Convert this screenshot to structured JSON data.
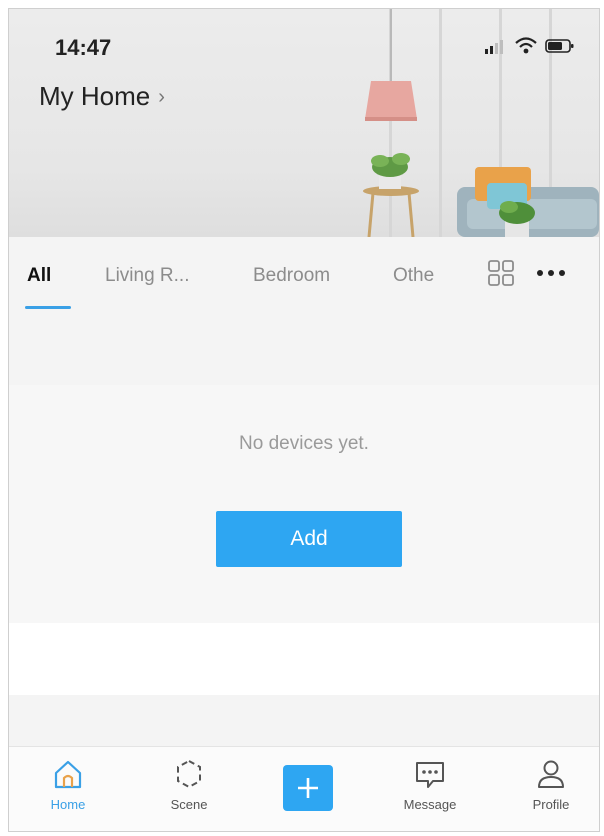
{
  "status_bar": {
    "time": "14:47"
  },
  "header": {
    "home_name": "My Home",
    "chevron": "›"
  },
  "tabs": [
    {
      "label": "All",
      "active": true
    },
    {
      "label": "Living R..."
    },
    {
      "label": "Bedroom"
    },
    {
      "label": "Othe"
    }
  ],
  "empty_state": {
    "message": "No devices yet.",
    "add_label": "Add"
  },
  "bottom_nav": {
    "items": [
      {
        "label": "Home",
        "icon": "home-icon",
        "active": true
      },
      {
        "label": "Scene",
        "icon": "scene-icon"
      },
      {
        "label": "Message",
        "icon": "message-icon"
      },
      {
        "label": "Profile",
        "icon": "profile-icon"
      }
    ],
    "center_icon": "plus-icon"
  },
  "colors": {
    "accent": "#2ea6f2",
    "active_tab_underline": "#3aa0e6",
    "background": "#f4f4f4"
  }
}
